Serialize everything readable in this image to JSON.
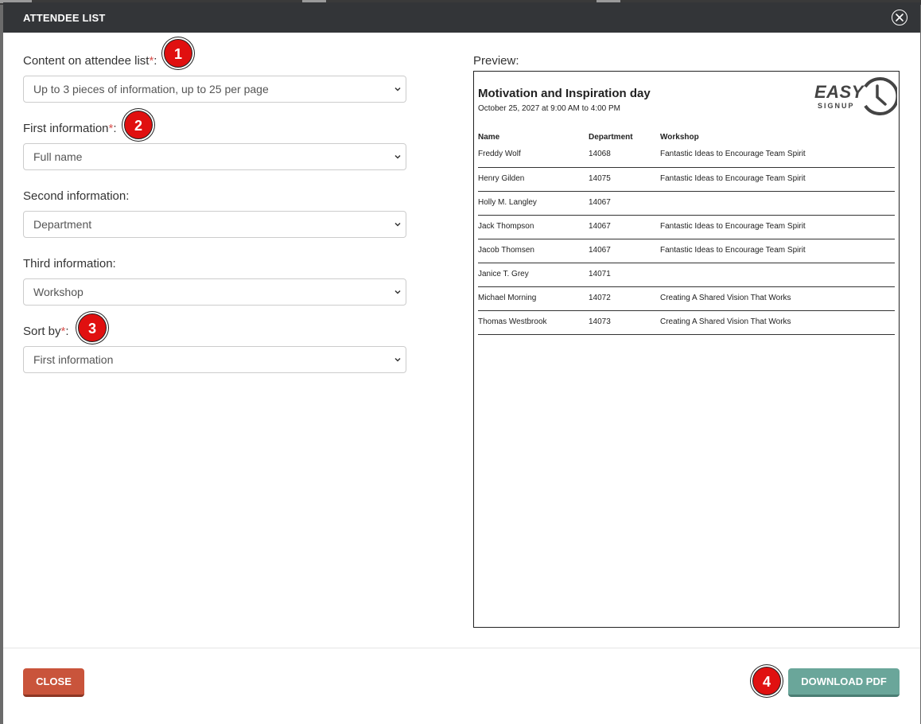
{
  "modal": {
    "title": "ATTENDEE LIST"
  },
  "form": {
    "content_label": "Content on attendee list",
    "content_value": "Up to 3 pieces of information, up to 25 per page",
    "first_label": "First information",
    "first_value": "Full name",
    "second_label": "Second information:",
    "second_value": "Department",
    "third_label": "Third information:",
    "third_value": "Workshop",
    "sort_label": "Sort by",
    "sort_value": "First information",
    "required_mark": "*",
    "colon": ":"
  },
  "badges": [
    "1",
    "2",
    "3",
    "4"
  ],
  "preview": {
    "label": "Preview:",
    "title": "Motivation and Inspiration day",
    "date": "October 25, 2027 at 9:00 AM to 4:00 PM",
    "logo_top": "EASY",
    "logo_bottom": "SIGNUP",
    "columns": [
      "Name",
      "Department",
      "Workshop"
    ],
    "rows": [
      [
        "Freddy Wolf",
        "14068",
        "Fantastic Ideas to Encourage Team Spirit"
      ],
      [
        "Henry Gilden",
        "14075",
        "Fantastic Ideas to Encourage Team Spirit"
      ],
      [
        "Holly M. Langley",
        "14067",
        ""
      ],
      [
        "Jack Thompson",
        "14067",
        "Fantastic Ideas to Encourage Team Spirit"
      ],
      [
        "Jacob Thomsen",
        "14067",
        "Fantastic Ideas to Encourage Team Spirit"
      ],
      [
        "Janice T. Grey",
        "14071",
        ""
      ],
      [
        "Michael Morning",
        "14072",
        "Creating A Shared Vision That Works"
      ],
      [
        "Thomas Westbrook",
        "14073",
        "Creating A Shared Vision That Works"
      ]
    ]
  },
  "footer": {
    "close_label": "CLOSE",
    "download_label": "DOWNLOAD PDF"
  },
  "colors": {
    "header_bg": "#333538",
    "close_btn": "#c9543b",
    "download_btn": "#6aa69a",
    "badge": "#e01010",
    "required": "#d9534f"
  }
}
